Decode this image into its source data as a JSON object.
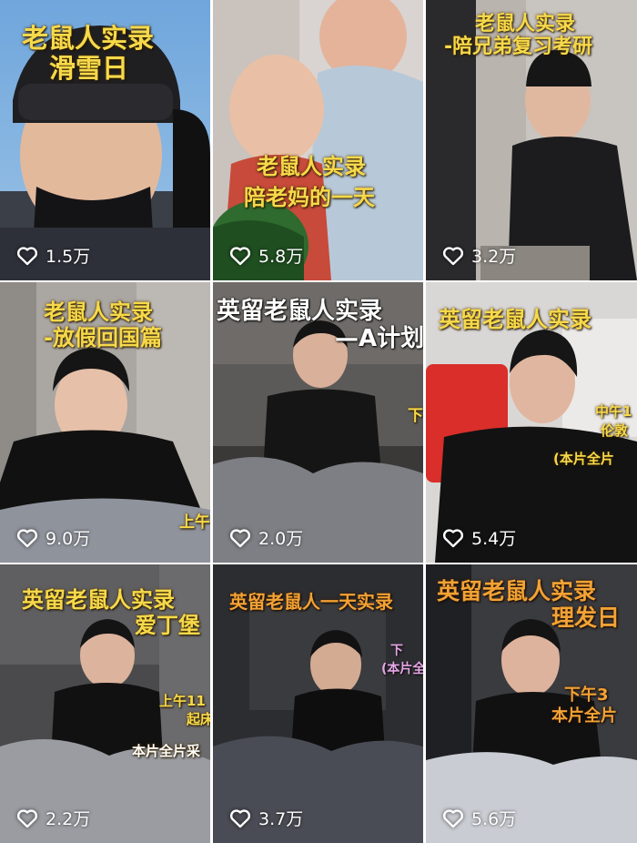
{
  "videos": [
    {
      "caption_lines": [
        "老鼠人实录",
        "滑雪日"
      ],
      "likes": "1.5万"
    },
    {
      "caption_lines": [
        "老鼠人实录",
        "陪老妈的一天"
      ],
      "likes": "5.8万"
    },
    {
      "caption_lines": [
        "老鼠人实录",
        "-陪兄弟复习考研"
      ],
      "likes": "3.2万"
    },
    {
      "caption_lines": [
        "老鼠人实录",
        "-放假回国篇"
      ],
      "overlay": "上午",
      "likes": "9.0万"
    },
    {
      "caption_lines": [
        "英留老鼠人实录",
        "—A计划"
      ],
      "overlay": "下",
      "likes": "2.0万"
    },
    {
      "caption_lines": [
        "英留老鼠人实录"
      ],
      "overlay_lines": [
        "中午1",
        "伦敦",
        "(本片全片"
      ],
      "likes": "5.4万"
    },
    {
      "caption_lines": [
        "英留老鼠人实录",
        "爱丁堡"
      ],
      "overlay_lines": [
        "上午11",
        "起床",
        "本片全片采"
      ],
      "likes": "2.2万"
    },
    {
      "caption_lines": [
        "英留老鼠人一天实录"
      ],
      "overlay_lines": [
        "下",
        "(本片全"
      ],
      "likes": "3.7万"
    },
    {
      "caption_lines": [
        "英留老鼠人实录",
        "理发日"
      ],
      "overlay_lines": [
        "下午3",
        "本片全片"
      ],
      "likes": "5.6万"
    }
  ],
  "icons": {
    "like": "heart-outline-icon"
  },
  "colors": {
    "caption_yellow": "#f6d94a",
    "caption_orange": "#f2a235",
    "like_text": "#ffffff"
  }
}
